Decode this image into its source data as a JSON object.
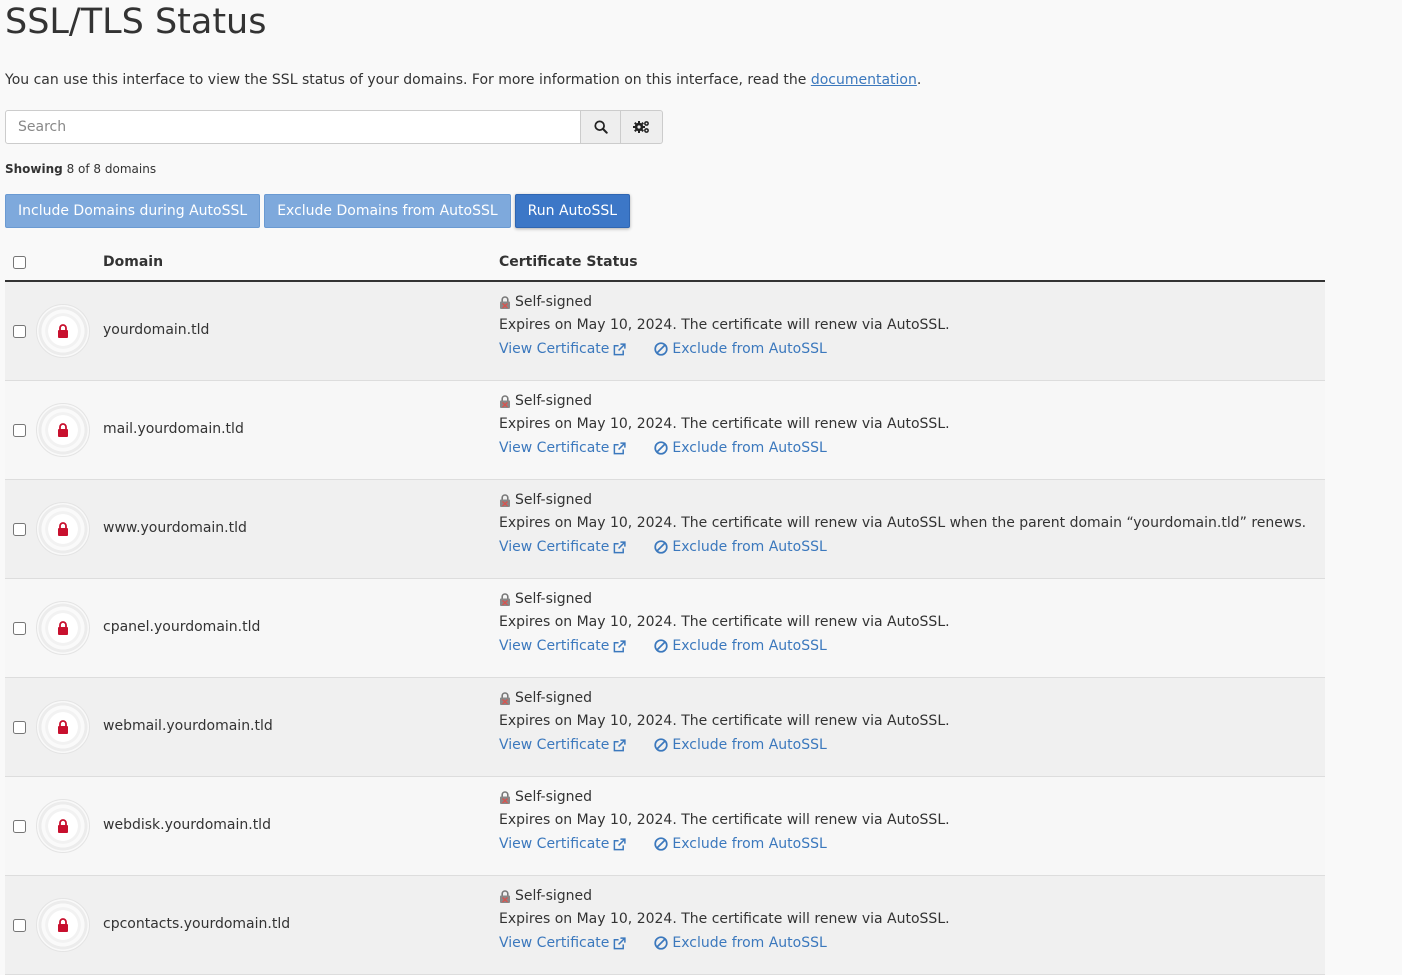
{
  "page": {
    "title": "SSL/TLS Status",
    "intro_text": "You can use this interface to view the SSL status of your domains. For more information on this interface, read the ",
    "intro_link": "documentation",
    "intro_end": "."
  },
  "search": {
    "placeholder": "Search",
    "search_icon": "search-icon",
    "settings_icon": "gears-icon"
  },
  "showing": {
    "label": "Showing",
    "text": "8 of 8 domains"
  },
  "actions": {
    "include": "Include Domains during AutoSSL",
    "exclude": "Exclude Domains from AutoSSL",
    "run": "Run AutoSSL"
  },
  "table": {
    "headers": {
      "domain": "Domain",
      "status": "Certificate Status"
    },
    "rows": [
      {
        "domain": "yourdomain.tld",
        "type": "Self-signed",
        "expires": "Expires on May 10, 2024. The certificate will renew via AutoSSL.",
        "view": "View Certificate",
        "exclude": "Exclude from AutoSSL"
      },
      {
        "domain": "mail.yourdomain.tld",
        "type": "Self-signed",
        "expires": "Expires on May 10, 2024. The certificate will renew via AutoSSL.",
        "view": "View Certificate",
        "exclude": "Exclude from AutoSSL"
      },
      {
        "domain": "www.yourdomain.tld",
        "type": "Self-signed",
        "expires": "Expires on May 10, 2024. The certificate will renew via AutoSSL when the parent domain “yourdomain.tld” renews.",
        "view": "View Certificate",
        "exclude": "Exclude from AutoSSL"
      },
      {
        "domain": "cpanel.yourdomain.tld",
        "type": "Self-signed",
        "expires": "Expires on May 10, 2024. The certificate will renew via AutoSSL.",
        "view": "View Certificate",
        "exclude": "Exclude from AutoSSL"
      },
      {
        "domain": "webmail.yourdomain.tld",
        "type": "Self-signed",
        "expires": "Expires on May 10, 2024. The certificate will renew via AutoSSL.",
        "view": "View Certificate",
        "exclude": "Exclude from AutoSSL"
      },
      {
        "domain": "webdisk.yourdomain.tld",
        "type": "Self-signed",
        "expires": "Expires on May 10, 2024. The certificate will renew via AutoSSL.",
        "view": "View Certificate",
        "exclude": "Exclude from AutoSSL"
      },
      {
        "domain": "cpcontacts.yourdomain.tld",
        "type": "Self-signed",
        "expires": "Expires on May 10, 2024. The certificate will renew via AutoSSL.",
        "view": "View Certificate",
        "exclude": "Exclude from AutoSSL"
      }
    ]
  },
  "colors": {
    "link": "#3b78bd",
    "lock_red": "#c8102e",
    "button_light": "#7ea9dc",
    "button_primary": "#3c77c7"
  }
}
